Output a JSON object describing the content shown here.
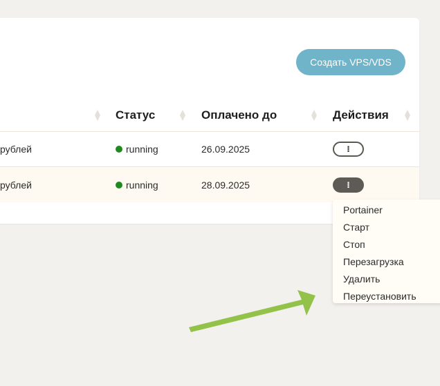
{
  "toolbar": {
    "create_label": "Создать VPS/VDS"
  },
  "table": {
    "headers": {
      "status": "Статус",
      "paid_until": "Оплачено до",
      "actions": "Действия"
    },
    "rows": [
      {
        "price": "рублей",
        "status": "running",
        "paid_until": "26.09.2025",
        "action": "⁝"
      },
      {
        "price": "рублей",
        "status": "running",
        "paid_until": "28.09.2025",
        "action": "⁝"
      }
    ]
  },
  "menu": {
    "items": [
      "Portainer",
      "Старт",
      "Стоп",
      "Перезагрузка",
      "Удалить",
      "Переустановить"
    ]
  },
  "colors": {
    "accent": "#6fb4c8",
    "status_running": "#1f8a1f",
    "arrow": "#8cbf3f",
    "page_bg": "#f2f1ee"
  }
}
